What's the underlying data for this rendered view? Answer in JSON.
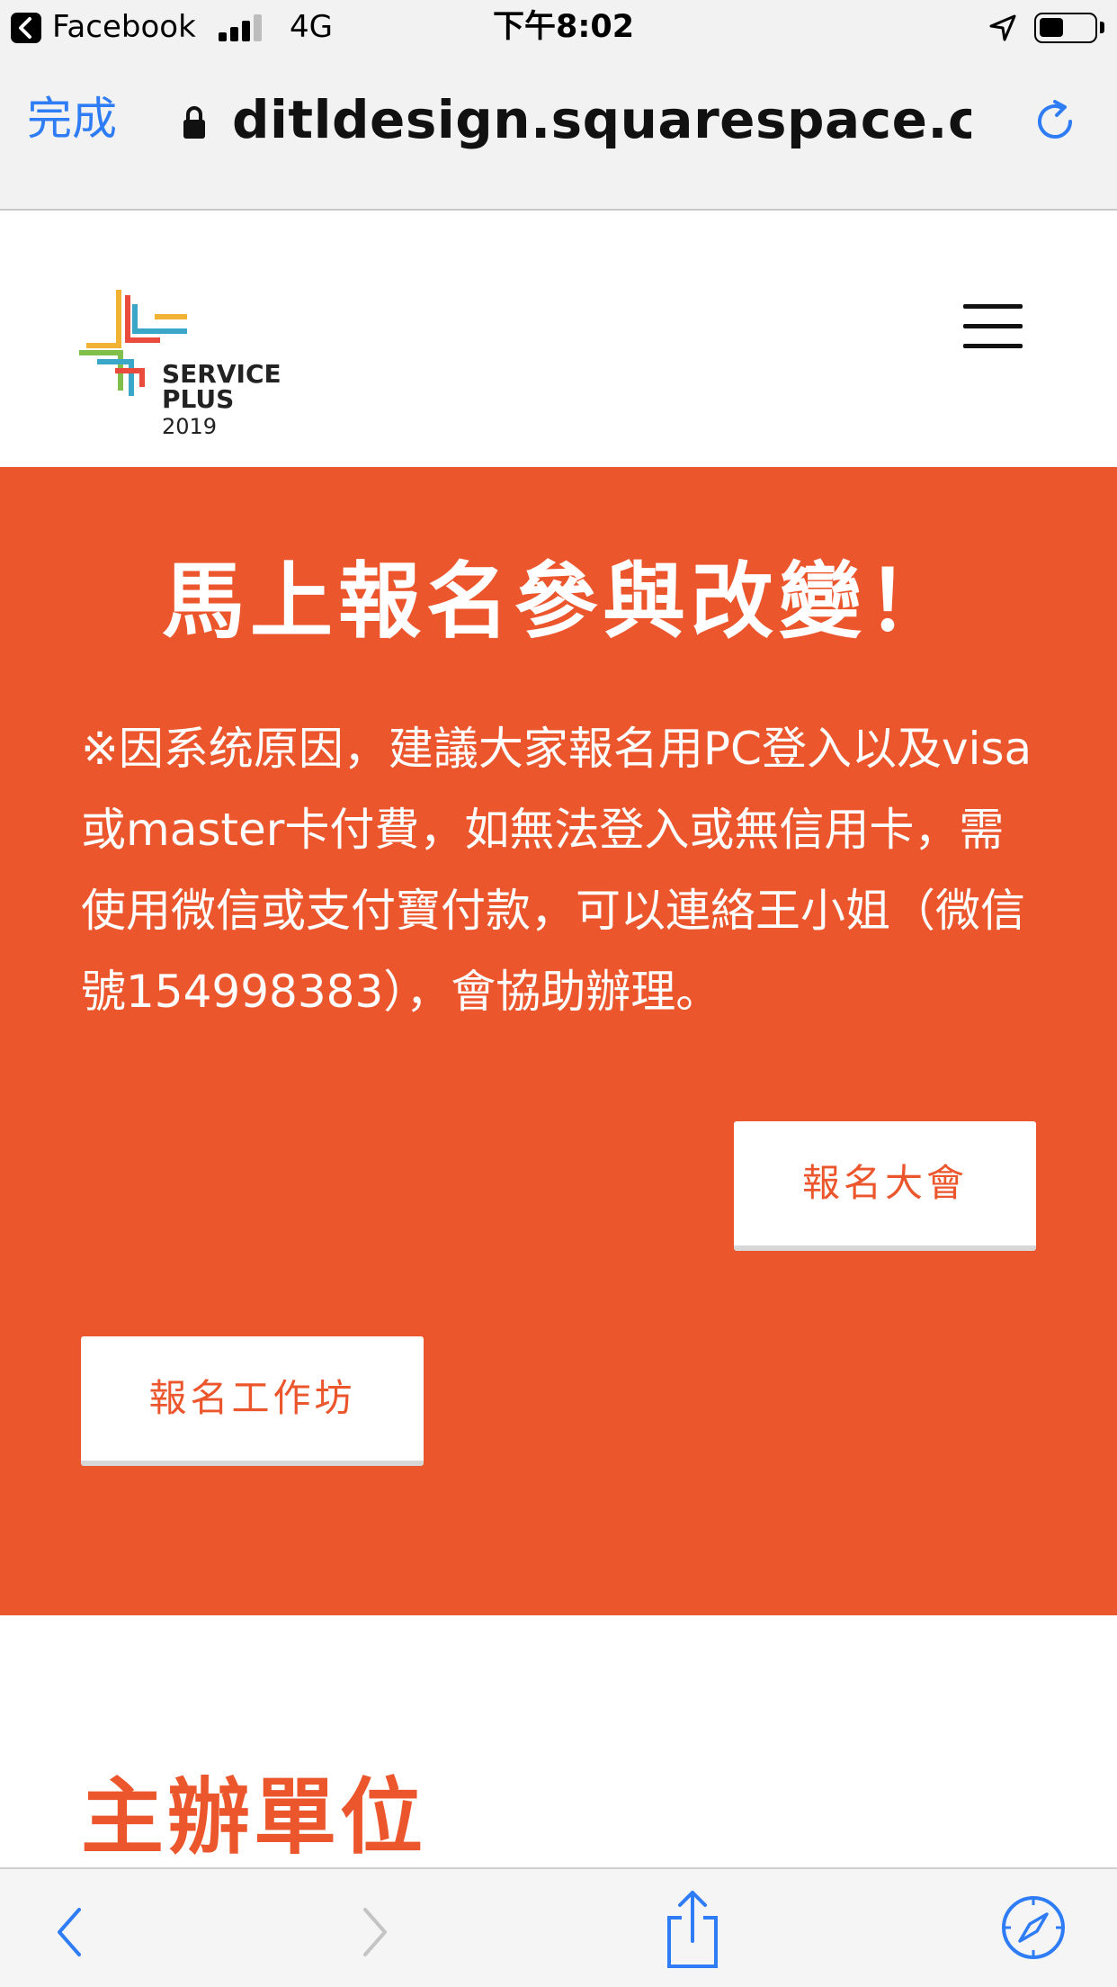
{
  "status_bar": {
    "back_app": "Facebook",
    "network": "4G",
    "time": "下午8:02"
  },
  "url_bar": {
    "done_label": "完成",
    "url": "ditldesign.squarespace.com"
  },
  "site_header": {
    "logo": {
      "line1": "SERVICE",
      "line2": "PLUS",
      "year": "2019"
    }
  },
  "hero": {
    "headline": "馬上報名參與改變！",
    "notice": "※因系统原因，建議大家報名用PC登入以及visa或master卡付費，如無法登入或無信用卡，需使用微信或支付寶付款，可以連絡王小姐（微信號154998383），會協助辦理。",
    "button_conference": "報名大會",
    "button_workshop": "報名工作坊"
  },
  "organizer": {
    "title": "主辦單位"
  },
  "colors": {
    "accent": "#ec562d",
    "link_blue": "#2e7cf6"
  }
}
